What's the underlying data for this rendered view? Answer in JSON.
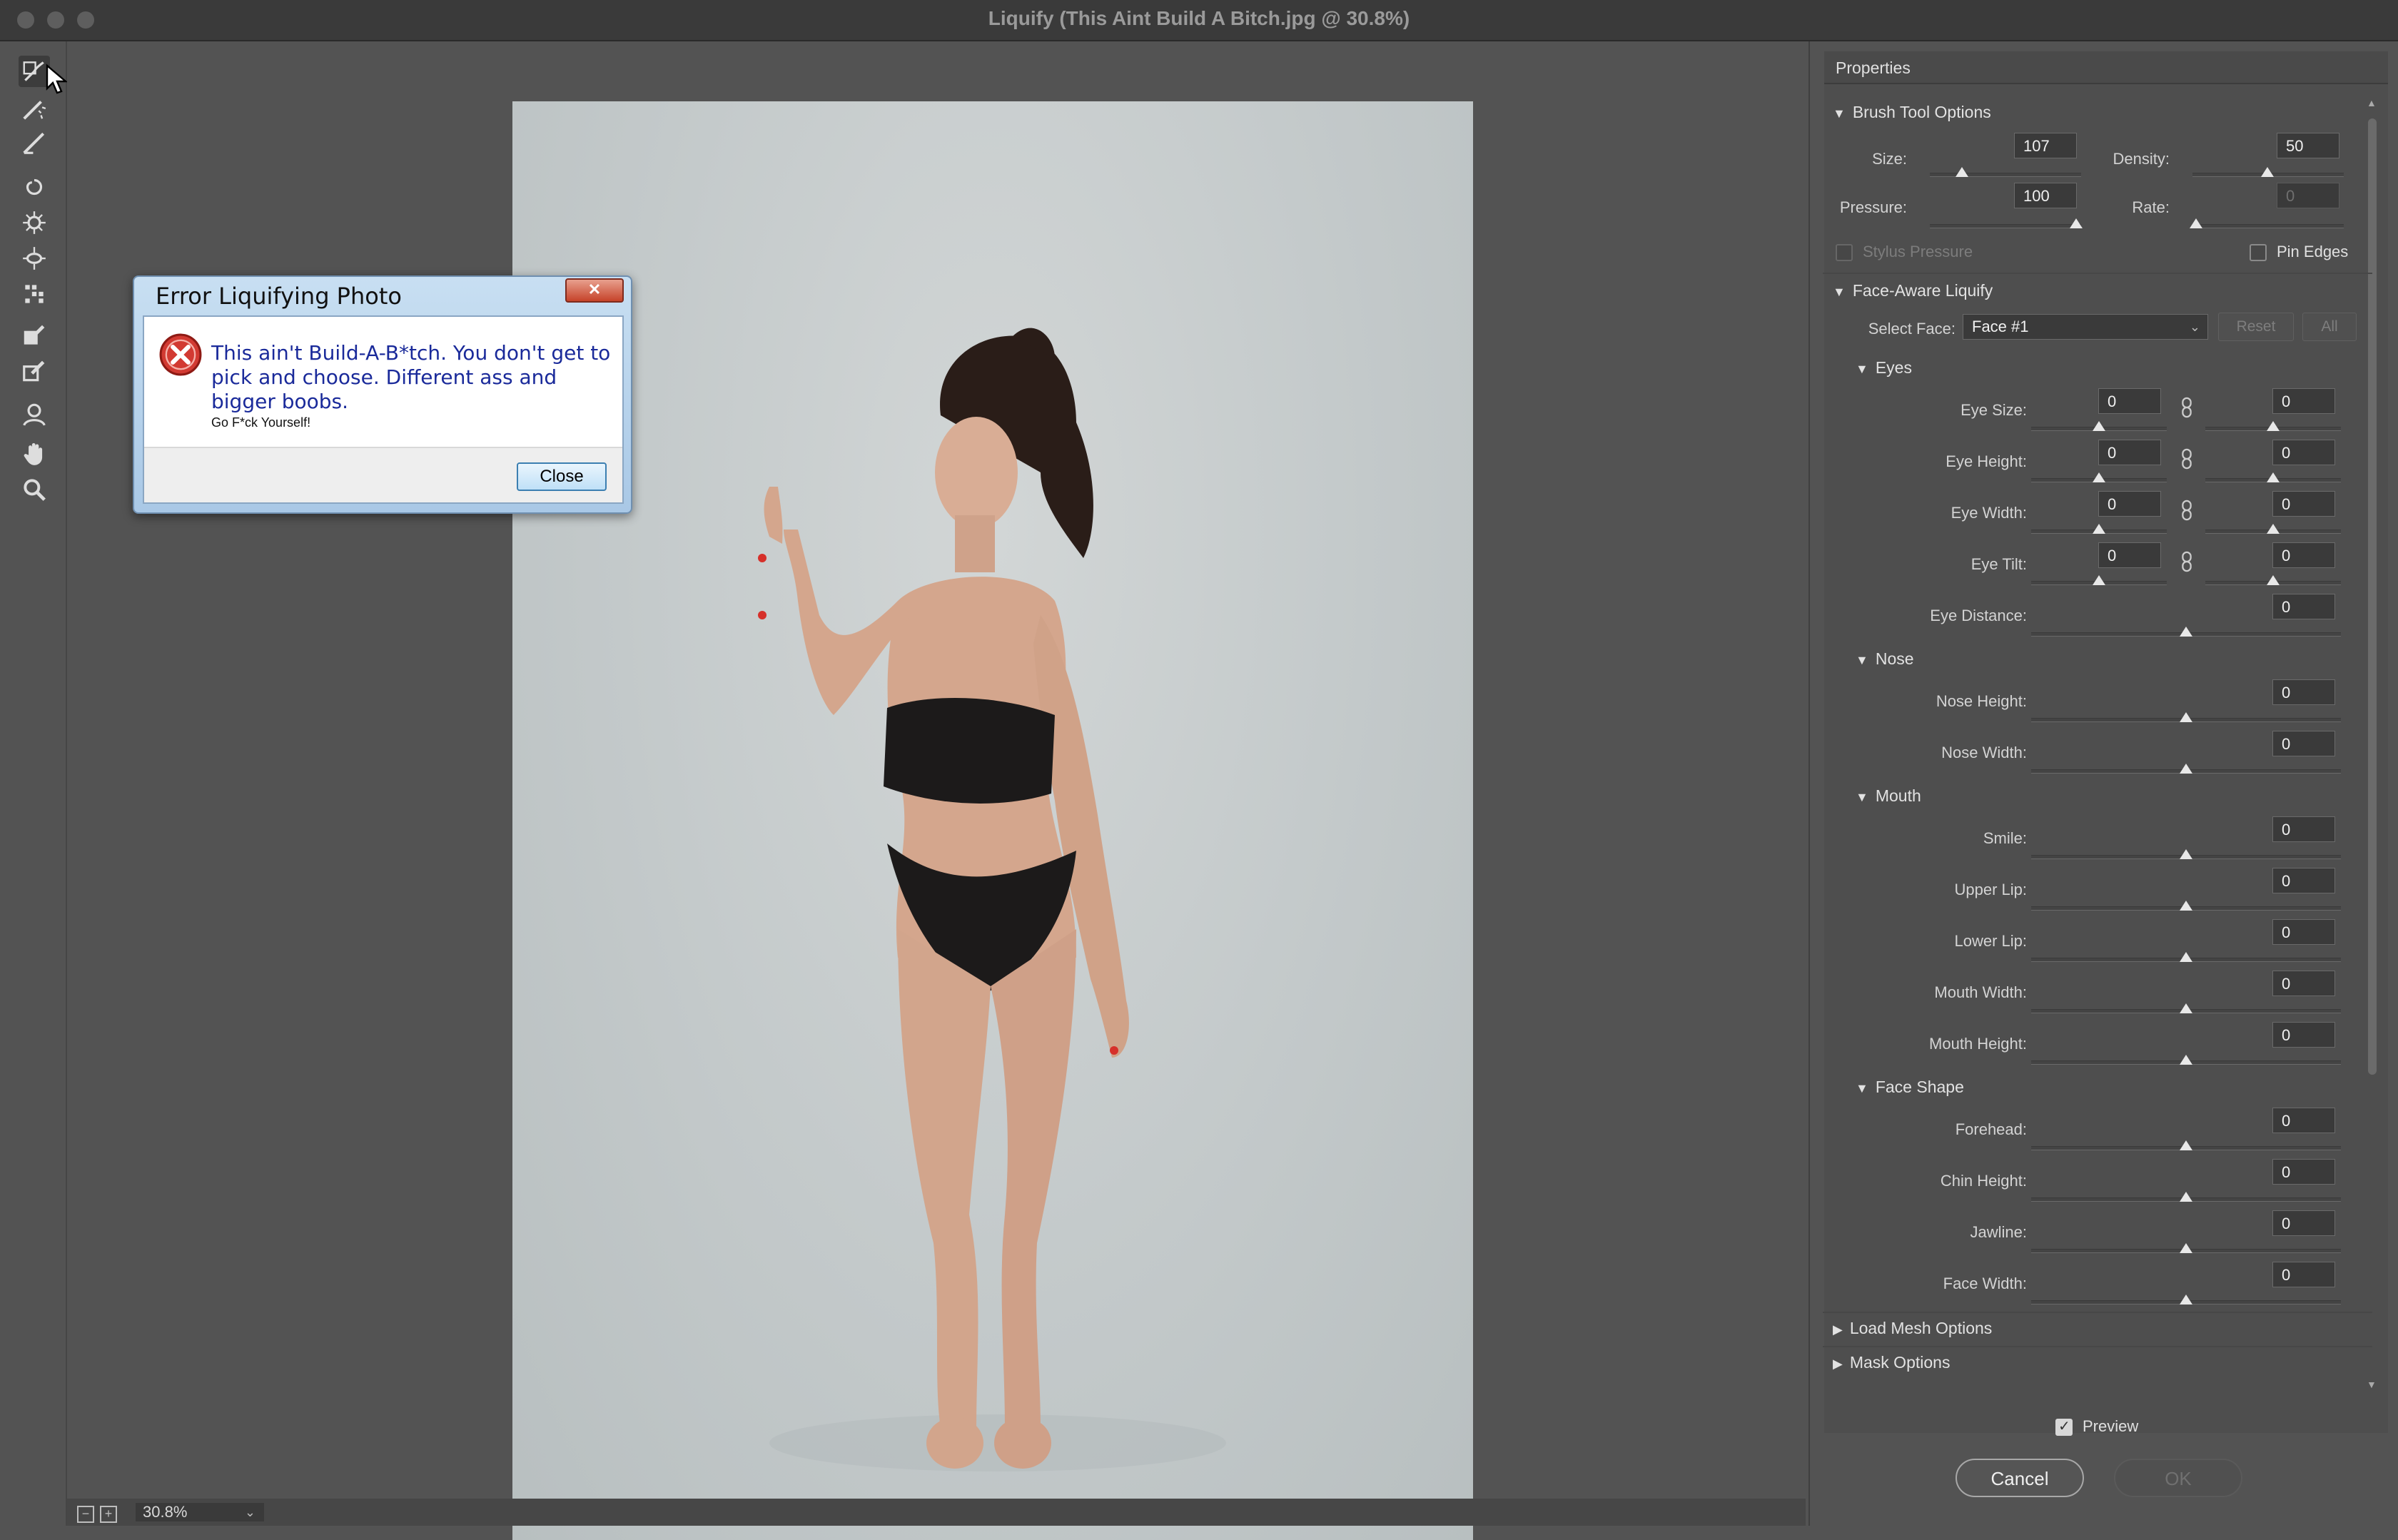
{
  "window": {
    "title": "Liquify (This Aint Build A Bitch.jpg @ 30.8%)"
  },
  "toolbar": {
    "tools": [
      "forward-warp-icon",
      "reconstruct-icon",
      "smooth-icon",
      "twirl-icon",
      "pucker-icon",
      "bloat-icon",
      "push-left-icon",
      "freeze-mask-icon",
      "thaw-mask-icon",
      "face-tool-icon",
      "hand-icon",
      "zoom-icon"
    ]
  },
  "status": {
    "zoom": "30.8%"
  },
  "dialog": {
    "title": "Error Liquifying Photo",
    "message": "This ain't Build-A-B*tch. You don't get to pick and choose. Different ass and bigger boobs.",
    "sub": "Go F*ck Yourself!",
    "close_label": "Close",
    "close_x": "✕"
  },
  "panel": {
    "title": "Properties",
    "brush": {
      "heading": "Brush Tool Options",
      "size_label": "Size:",
      "size": "107",
      "density_label": "Density:",
      "density": "50",
      "pressure_label": "Pressure:",
      "pressure": "100",
      "rate_label": "Rate:",
      "rate": "0",
      "stylus_label": "Stylus Pressure",
      "pin_label": "Pin Edges"
    },
    "face": {
      "heading": "Face-Aware Liquify",
      "select_label": "Select Face:",
      "select_value": "Face #1",
      "reset_label": "Reset",
      "all_label": "All",
      "eyes": {
        "heading": "Eyes",
        "rows": [
          {
            "label": "Eye Size:",
            "left": "0",
            "right": "0"
          },
          {
            "label": "Eye Height:",
            "left": "0",
            "right": "0"
          },
          {
            "label": "Eye Width:",
            "left": "0",
            "right": "0"
          },
          {
            "label": "Eye Tilt:",
            "left": "0",
            "right": "0"
          }
        ],
        "distance_label": "Eye Distance:",
        "distance": "0"
      },
      "nose": {
        "heading": "Nose",
        "rows": [
          {
            "label": "Nose Height:",
            "value": "0"
          },
          {
            "label": "Nose Width:",
            "value": "0"
          }
        ]
      },
      "mouth": {
        "heading": "Mouth",
        "rows": [
          {
            "label": "Smile:",
            "value": "0"
          },
          {
            "label": "Upper Lip:",
            "value": "0"
          },
          {
            "label": "Lower Lip:",
            "value": "0"
          },
          {
            "label": "Mouth Width:",
            "value": "0"
          },
          {
            "label": "Mouth Height:",
            "value": "0"
          }
        ]
      },
      "shape": {
        "heading": "Face Shape",
        "rows": [
          {
            "label": "Forehead:",
            "value": "0"
          },
          {
            "label": "Chin Height:",
            "value": "0"
          },
          {
            "label": "Jawline:",
            "value": "0"
          },
          {
            "label": "Face Width:",
            "value": "0"
          }
        ]
      }
    },
    "load_mesh": "Load Mesh Options",
    "mask_options": "Mask Options",
    "preview_label": "Preview",
    "cancel_label": "Cancel",
    "ok_label": "OK"
  }
}
